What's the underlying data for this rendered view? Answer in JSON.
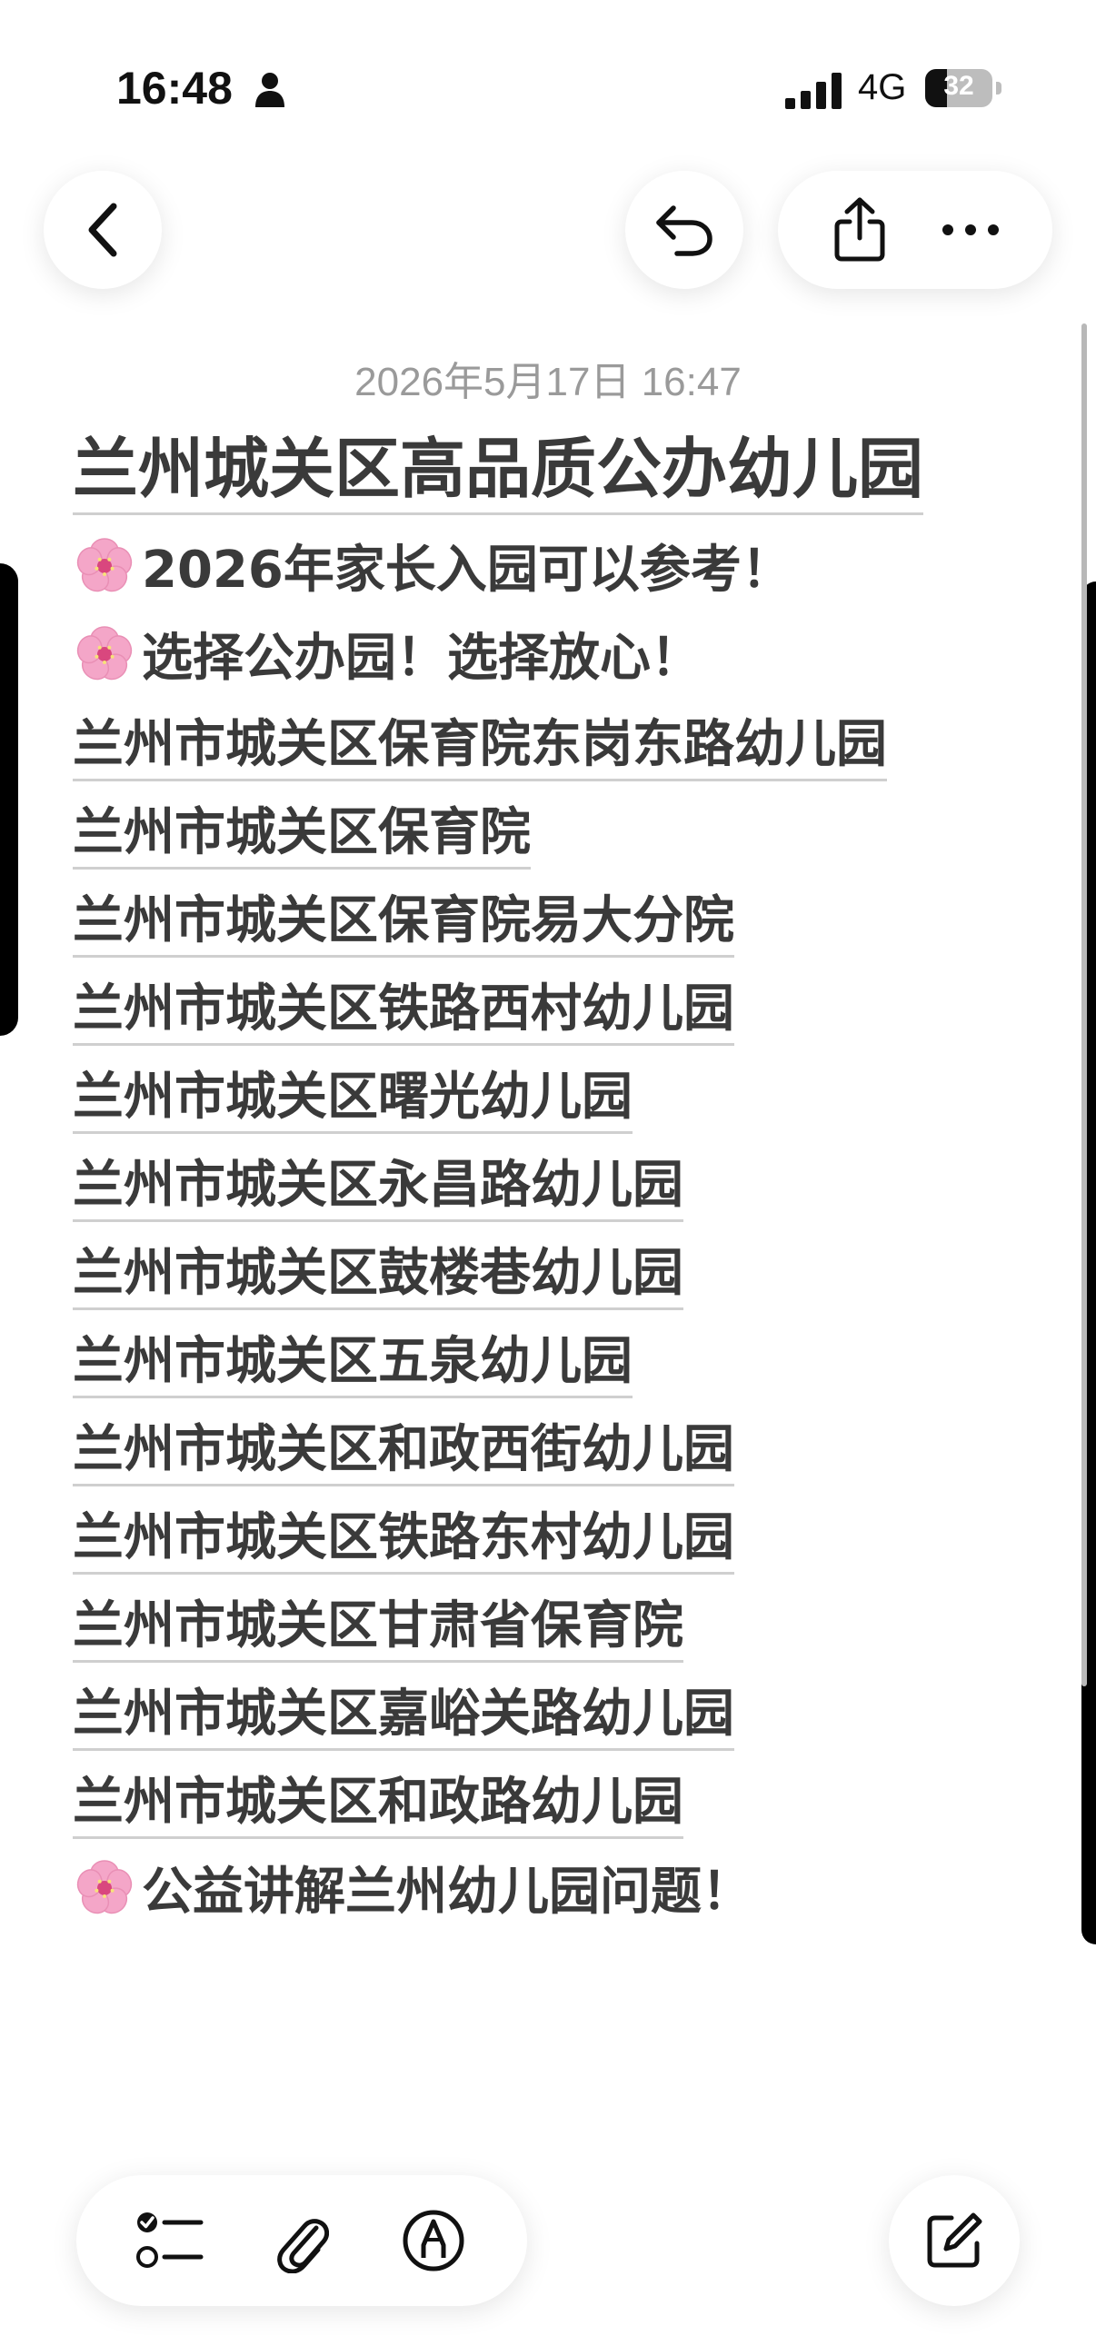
{
  "status_bar": {
    "time": "16:48",
    "network": "4G",
    "battery": "32",
    "battery_level": 0.32,
    "icons": [
      "person-icon",
      "signal-icon",
      "battery-icon"
    ]
  },
  "nav": {
    "back_icon": "chevron-left-icon",
    "undo_icon": "undo-icon",
    "share_icon": "share-icon",
    "more_icon": "more-icon"
  },
  "note": {
    "date": "2026年5月17日 16:47",
    "title": "兰州城关区高品质公办幼儿园",
    "lines": [
      {
        "text": "2026年家长入园可以参考！",
        "emoji": "cherry-blossom-icon",
        "linked": false
      },
      {
        "text": "选择公办园！选择放心！",
        "emoji": "cherry-blossom-icon",
        "linked": false
      },
      {
        "text": "兰州市城关区保育院东岗东路幼儿园",
        "linked": true
      },
      {
        "text": "兰州市城关区保育院",
        "linked": true
      },
      {
        "text": "兰州市城关区保育院易大分院",
        "linked": true
      },
      {
        "text": "兰州市城关区铁路西村幼儿园",
        "linked": true
      },
      {
        "text": "兰州市城关区曙光幼儿园",
        "linked": true
      },
      {
        "text": "兰州市城关区永昌路幼儿园",
        "linked": true
      },
      {
        "text": "兰州市城关区鼓楼巷幼儿园",
        "linked": true
      },
      {
        "text": "兰州市城关区五泉幼儿园",
        "linked": true
      },
      {
        "text": "兰州市城关区和政西街幼儿园",
        "linked": true
      },
      {
        "text": "兰州市城关区铁路东村幼儿园",
        "linked": true
      },
      {
        "text": "兰州市城关区甘肃省保育院",
        "linked": true
      },
      {
        "text": "兰州市城关区嘉峪关路幼儿园",
        "linked": true
      },
      {
        "text": "兰州市城关区和政路幼儿园",
        "linked": true
      },
      {
        "text": "公益讲解兰州幼儿园问题！",
        "emoji": "cherry-blossom-icon",
        "linked": false
      }
    ]
  },
  "toolbar": {
    "checklist_icon": "checklist-icon",
    "attachment_icon": "paperclip-icon",
    "markup_icon": "markup-pen-icon",
    "compose_icon": "compose-icon"
  },
  "colors": {
    "text": "#3a3a3a",
    "date": "#9a9a9a",
    "blossom": "#f4a6c8",
    "blossom_center": "#d9477e"
  }
}
